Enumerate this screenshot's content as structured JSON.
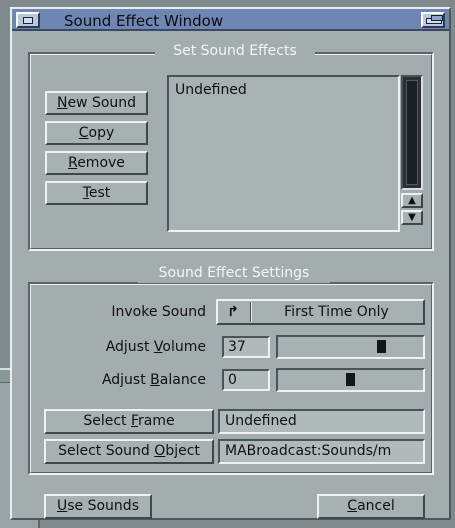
{
  "window": {
    "title": "Sound Effect Window"
  },
  "set_group": {
    "title": "Set Sound Effects",
    "buttons": {
      "new_sound": {
        "pre": "",
        "key": "N",
        "post": "ew Sound"
      },
      "copy": {
        "pre": "",
        "key": "C",
        "post": "opy"
      },
      "remove": {
        "pre": "",
        "key": "R",
        "post": "emove"
      },
      "test": {
        "pre": "",
        "key": "T",
        "post": "est"
      }
    },
    "list": {
      "items": [
        "Undefined"
      ]
    },
    "scroll": {
      "up": "▲",
      "down": "▼"
    }
  },
  "settings_group": {
    "title": "Sound Effect Settings",
    "invoke": {
      "label": "Invoke Sound",
      "cycle_glyph": "↱",
      "value": "First Time Only"
    },
    "volume": {
      "label_pre": "Adjust ",
      "label_key": "V",
      "label_post": "olume",
      "value": "37",
      "level": 37
    },
    "balance": {
      "label_pre": "Adjust ",
      "label_key": "B",
      "label_post": "alance",
      "value": "0",
      "level": 0
    },
    "select_frame": {
      "pre": "Select ",
      "key": "F",
      "post": "rame",
      "value": "Undefined"
    },
    "select_object": {
      "pre": "Select Sound ",
      "key": "O",
      "post": "bject",
      "value": "MABroadcast:Sounds/m"
    }
  },
  "footer": {
    "use_sounds": {
      "pre": "",
      "key": "U",
      "post": "se Sounds"
    },
    "cancel": {
      "pre": "",
      "key": "C",
      "post": "ancel"
    }
  },
  "colors": {
    "titlebar": "#6e86b2",
    "window": "#a3adae",
    "desktop": "#7f8a8c"
  }
}
